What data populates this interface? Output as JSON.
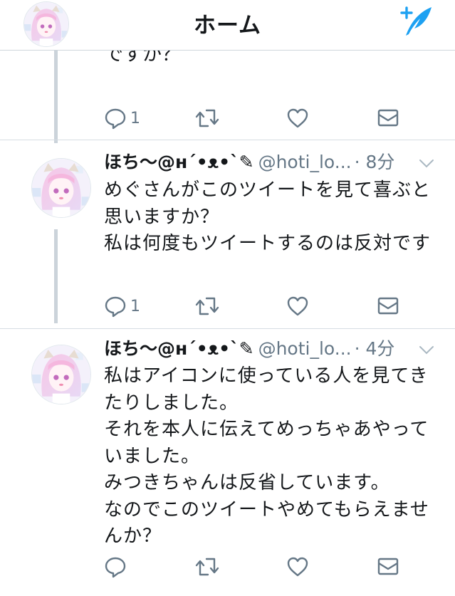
{
  "header": {
    "title": "ホーム"
  },
  "thread": {
    "cut_text": "ですか？",
    "prev_actions": {
      "reply_count": "1"
    }
  },
  "tweets": [
    {
      "name": "ほち〜@ʜ´•ᴥ•`✎",
      "handle": "@hoti_lo...",
      "time": "· 8分",
      "text": "めぐさんがこのツイートを見て喜ぶと思いますか？\n私は何度もツイートするのは反対です",
      "reply_count": "1"
    },
    {
      "name": "ほち〜@ʜ´•ᴥ•`✎",
      "handle": "@hoti_lo...",
      "time": "· 4分",
      "text": "私はアイコンに使っている人を見てきたりしました。\nそれを本人に伝えてめっちゃあやっていました。\nみつきちゃんは反省しています。\nなのでこのツイートやめてもらえませんか？",
      "reply_count": ""
    }
  ],
  "colors": {
    "accent": "#1da1f2",
    "muted": "#657786",
    "text": "#14171a",
    "thread_line": "#cbd3da"
  },
  "icons": [
    "compose-icon",
    "reply-icon",
    "retweet-icon",
    "like-icon",
    "dm-icon",
    "chevron-down-icon"
  ]
}
